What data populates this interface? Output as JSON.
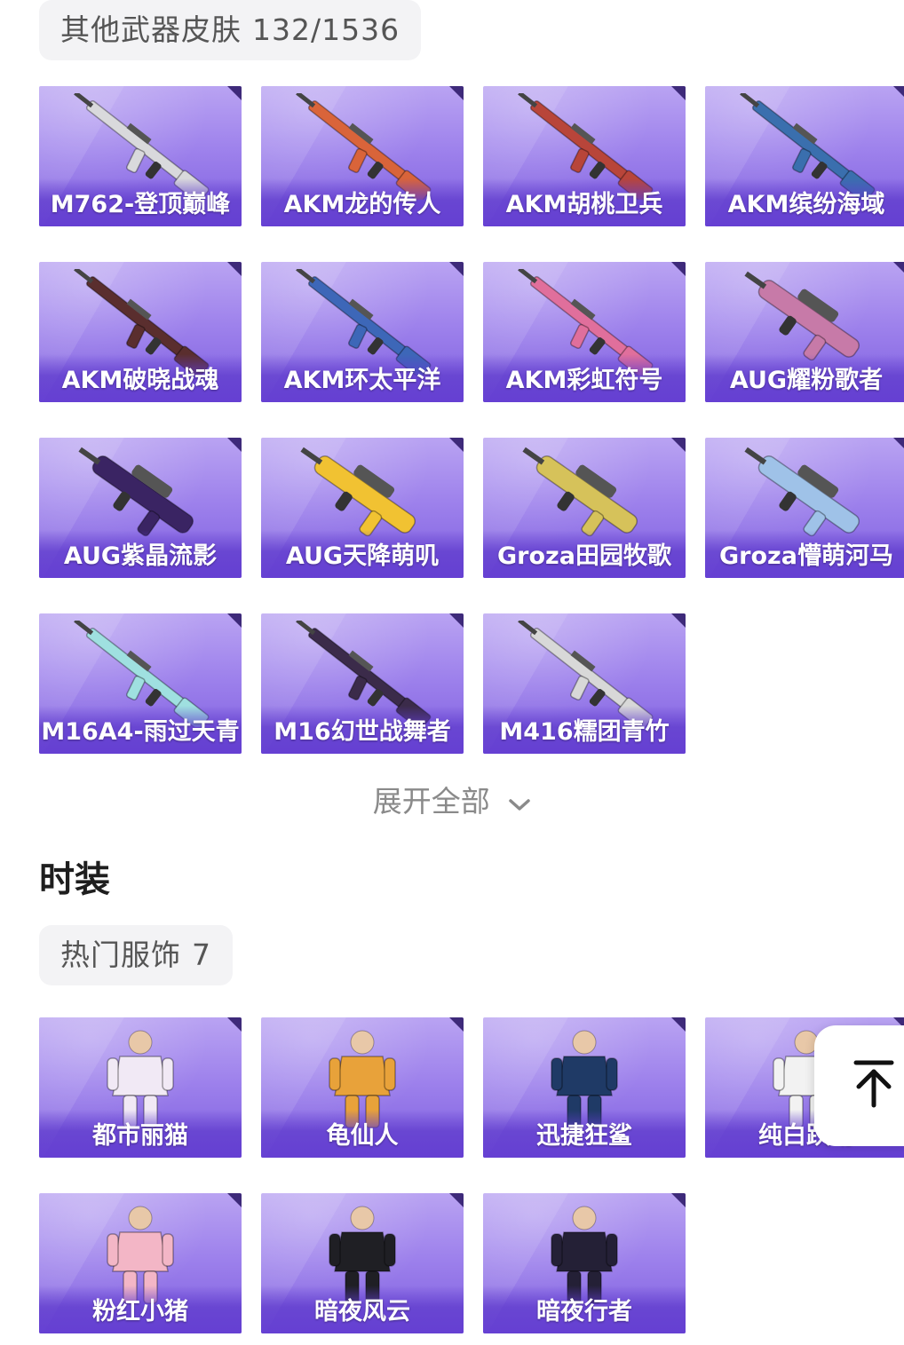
{
  "weapons_section": {
    "category_label": "其他武器皮肤",
    "count": "132/1536",
    "items": [
      {
        "name": "M762-登顶巅峰",
        "color": "#d9d9dc",
        "icon": "rifle-icon"
      },
      {
        "name": "AKM龙的传人",
        "color": "#d9643a",
        "icon": "rifle-icon"
      },
      {
        "name": "AKM胡桃卫兵",
        "color": "#b8453a",
        "icon": "rifle-icon"
      },
      {
        "name": "AKM缤纷海域",
        "color": "#3a6fae",
        "icon": "rifle-icon"
      },
      {
        "name": "AKM破晓战魂",
        "color": "#5a2e2e",
        "icon": "rifle-icon"
      },
      {
        "name": "AKM环太平洋",
        "color": "#3d67b8",
        "icon": "rifle-icon"
      },
      {
        "name": "AKM彩虹符号",
        "color": "#e06f9c",
        "icon": "rifle-icon"
      },
      {
        "name": "AUG耀粉歌者",
        "color": "#c77aa8",
        "icon": "bullpup-icon"
      },
      {
        "name": "AUG紫晶流影",
        "color": "#3a2463",
        "icon": "bullpup-icon"
      },
      {
        "name": "AUG天降萌叽",
        "color": "#f1c232",
        "icon": "bullpup-icon"
      },
      {
        "name": "Groza田园牧歌",
        "color": "#d6c25a",
        "icon": "bullpup-icon"
      },
      {
        "name": "Groza懵萌河马",
        "color": "#9fc2e8",
        "icon": "bullpup-icon"
      },
      {
        "name": "M16A4-雨过天青",
        "color": "#9fe0e0",
        "icon": "rifle-icon"
      },
      {
        "name": "M16幻世战舞者",
        "color": "#3b2b4a",
        "icon": "rifle-icon"
      },
      {
        "name": "M416糯团青竹",
        "color": "#d8d8d8",
        "icon": "rifle-icon"
      }
    ],
    "expand_label": "展开全部",
    "expand_icon": "chevron-down-icon"
  },
  "fashion_section": {
    "title": "时装",
    "category_label": "热门服饰",
    "count": "7",
    "items": [
      {
        "name": "都市丽猫",
        "color": "#f1e9f5",
        "icon": "outfit-icon"
      },
      {
        "name": "龟仙人",
        "color": "#e8a23a",
        "icon": "outfit-icon"
      },
      {
        "name": "迅捷狂鲨",
        "color": "#1f3a66",
        "icon": "outfit-icon"
      },
      {
        "name": "纯白跃动",
        "color": "#f2f2f2",
        "icon": "outfit-icon"
      },
      {
        "name": "粉红小猪",
        "color": "#f3b6c6",
        "icon": "outfit-icon"
      },
      {
        "name": "暗夜风云",
        "color": "#1f1f24",
        "icon": "outfit-icon"
      },
      {
        "name": "暗夜行者",
        "color": "#242036",
        "icon": "outfit-icon"
      }
    ]
  },
  "back_to_top": {
    "icon": "arrow-up-to-top-icon"
  },
  "colors": {
    "card_top": "#b9a3f2",
    "card_bottom": "#7f5fe0",
    "pill_bg": "#f3f3f5"
  }
}
